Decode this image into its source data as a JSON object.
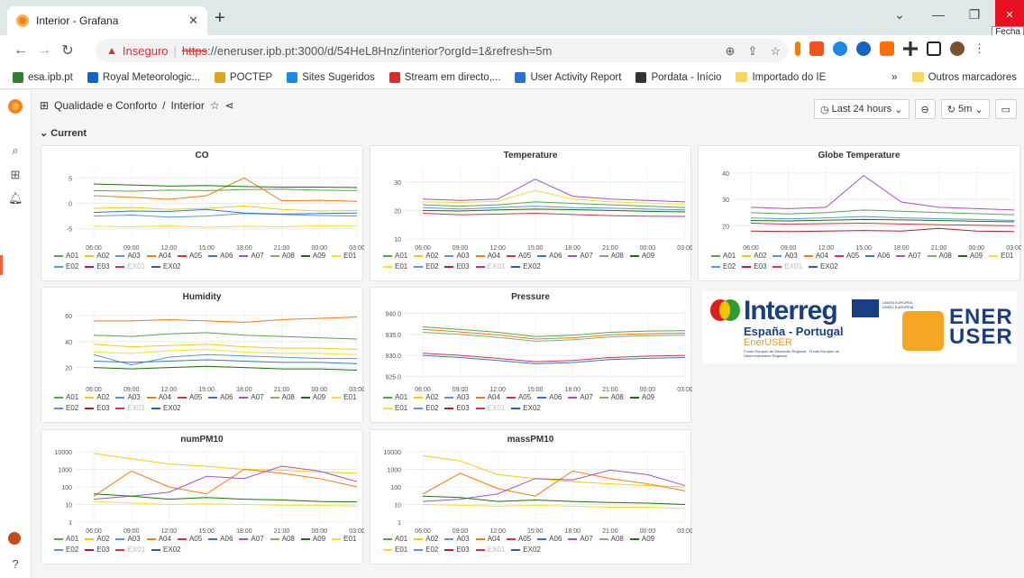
{
  "browser": {
    "tab_title": "Interior - Grafana",
    "close_tooltip": "Fecha",
    "url_warning": "Inseguro",
    "url_scheme": "https",
    "url_rest": "://eneruser.ipb.pt:3000/d/54HeL8Hnz/interior?orgId=1&refresh=5m",
    "bookmarks": [
      {
        "label": "esa.ipb.pt",
        "color": "#2e7d32"
      },
      {
        "label": "Royal Meteorologic...",
        "color": "#1565c0"
      },
      {
        "label": "POCTEP",
        "color": "#d9a71e"
      },
      {
        "label": "Sites Sugeridos",
        "color": "#1e88e5"
      },
      {
        "label": "Stream em directo,...",
        "color": "#d32f2f"
      },
      {
        "label": "User Activity Report",
        "color": "#2b6fd6"
      },
      {
        "label": "Pordata - Início",
        "color": "#333333"
      },
      {
        "label": "Importado do IE",
        "color": "#f7d565"
      }
    ],
    "bookmarks_overflow": "»",
    "other_bookmarks": "Outros marcadores"
  },
  "dashboard": {
    "folder": "Qualidade e Conforto",
    "sep": "/",
    "name": "Interior",
    "time_range": "Last 24 hours",
    "refresh": "5m",
    "row_title": "Current"
  },
  "legend_items": [
    {
      "name": "A01",
      "color": "#56a64b",
      "dim": false
    },
    {
      "name": "A02",
      "color": "#f2cc0c",
      "dim": false
    },
    {
      "name": "A03",
      "color": "#5794f2",
      "dim": false
    },
    {
      "name": "A04",
      "color": "#ff780a",
      "dim": false
    },
    {
      "name": "A05",
      "color": "#e02f44",
      "dim": false
    },
    {
      "name": "A06",
      "color": "#3274d9",
      "dim": false
    },
    {
      "name": "A07",
      "color": "#a352cc",
      "dim": false
    },
    {
      "name": "A08",
      "color": "#7eb26d",
      "dim": false
    },
    {
      "name": "A09",
      "color": "#19730e",
      "dim": false
    },
    {
      "name": "E01",
      "color": "#fade2a",
      "dim": false
    },
    {
      "name": "E02",
      "color": "#5794f2",
      "dim": false
    },
    {
      "name": "E03",
      "color": "#c4162a",
      "dim": false
    },
    {
      "name": "EX01",
      "color": "#e02f44",
      "dim": true
    },
    {
      "name": "EX02",
      "color": "#1f60c4",
      "dim": false
    }
  ],
  "x_ticks": [
    "06:00",
    "09:00",
    "12:00",
    "15:00",
    "18:00",
    "21:00",
    "00:00",
    "03:00"
  ],
  "panels": [
    {
      "title": "CO",
      "y_ticks": [
        "5",
        "0",
        "-5"
      ]
    },
    {
      "title": "Temperature",
      "y_ticks": [
        "30",
        "20",
        "10"
      ]
    },
    {
      "title": "Globe Temperature",
      "y_ticks": [
        "40",
        "30",
        "20"
      ]
    },
    {
      "title": "Humidity",
      "y_ticks": [
        "60",
        "40",
        "20"
      ]
    },
    {
      "title": "Pressure",
      "y_ticks": [
        "940.0",
        "935.0",
        "930.0",
        "925.0"
      ]
    },
    {
      "title": "numPM10",
      "y_ticks": [
        "10000",
        "1000",
        "100",
        "10",
        "1"
      ]
    },
    {
      "title": "massPM10",
      "y_ticks": [
        "10000",
        "1000",
        "100",
        "10",
        "1"
      ]
    }
  ],
  "logo": {
    "interreg": "Interreg",
    "region": "España - Portugal",
    "project": "EnerUSER",
    "fund": "Fondo Europeo de Desarrollo Regional · Fundo Europeu de Desenvolvimento Regional",
    "eu_label": "UNIÓN EUROPEA · UNIÃO EUROPEIA",
    "brand_l1": "ENER",
    "brand_l2": "USER"
  },
  "chart_data": [
    {
      "type": "line",
      "title": "CO",
      "x": [
        "06:00",
        "09:00",
        "12:00",
        "15:00",
        "18:00",
        "21:00",
        "00:00",
        "03:00"
      ],
      "ylim": [
        -7,
        7
      ],
      "series": [
        {
          "name": "A01",
          "values": [
            2.5,
            2.4,
            2.6,
            2.5,
            2.7,
            2.8,
            2.6,
            2.5
          ]
        },
        {
          "name": "A02",
          "values": [
            -1,
            -0.8,
            -1.2,
            -1,
            -0.5,
            -1.2,
            -1.5,
            -1.4
          ]
        },
        {
          "name": "A03",
          "values": [
            -2.5,
            -2.3,
            -2.7,
            -2.5,
            -2,
            -2.2,
            -2.4,
            -2.5
          ]
        },
        {
          "name": "A04",
          "values": [
            1.5,
            1.2,
            0.8,
            1.5,
            5,
            0.5,
            0.6,
            0.4
          ]
        },
        {
          "name": "A06",
          "values": [
            -1.8,
            -1.5,
            -1.6,
            -1.2,
            -1.9,
            -2.1,
            -2,
            -1.9
          ]
        },
        {
          "name": "A09",
          "values": [
            3.8,
            3.6,
            3.4,
            3.5,
            3.3,
            3.2,
            3.2,
            3.1
          ]
        },
        {
          "name": "E01",
          "values": [
            -4.5,
            -4.6,
            -4.4,
            -4.7,
            -4.5,
            -4.6,
            -4.4,
            -4.5
          ]
        }
      ]
    },
    {
      "type": "line",
      "title": "Temperature",
      "x": [
        "06:00",
        "09:00",
        "12:00",
        "15:00",
        "18:00",
        "21:00",
        "00:00",
        "03:00"
      ],
      "ylim": [
        10,
        35
      ],
      "series": [
        {
          "name": "A01",
          "values": [
            22,
            21.5,
            22,
            23,
            22.5,
            22,
            21.5,
            21
          ]
        },
        {
          "name": "A03",
          "values": [
            21,
            20.5,
            21,
            21.5,
            21,
            20.8,
            20.5,
            20.2
          ]
        },
        {
          "name": "A05",
          "values": [
            19,
            18.5,
            18.7,
            19,
            18.6,
            18.2,
            18,
            17.9
          ]
        },
        {
          "name": "A07",
          "values": [
            24,
            23.5,
            24,
            31,
            25,
            24,
            23.5,
            23
          ]
        },
        {
          "name": "A09",
          "values": [
            20,
            19.8,
            20.2,
            20.5,
            20.3,
            20,
            19.7,
            19.5
          ]
        },
        {
          "name": "E01",
          "values": [
            23,
            22.8,
            23.2,
            27,
            24,
            23,
            22.6,
            22.2
          ]
        }
      ]
    },
    {
      "type": "line",
      "title": "Globe Temperature",
      "x": [
        "06:00",
        "09:00",
        "12:00",
        "15:00",
        "18:00",
        "21:00",
        "00:00",
        "03:00"
      ],
      "ylim": [
        15,
        42
      ],
      "series": [
        {
          "name": "A01",
          "values": [
            25,
            24.5,
            25,
            26,
            25.5,
            25,
            24.6,
            24.2
          ]
        },
        {
          "name": "A03",
          "values": [
            23,
            22.6,
            23,
            23.5,
            23,
            22.7,
            22.4,
            22
          ]
        },
        {
          "name": "A05",
          "values": [
            21,
            20.6,
            20.8,
            21,
            20.7,
            20.4,
            20.2,
            20
          ]
        },
        {
          "name": "A07",
          "values": [
            27,
            26.5,
            27,
            39,
            29,
            27,
            26.5,
            26
          ]
        },
        {
          "name": "A09",
          "values": [
            22,
            21.8,
            22.1,
            22.4,
            22.2,
            22,
            21.7,
            21.5
          ]
        },
        {
          "name": "E03",
          "values": [
            18,
            17.8,
            18,
            18.2,
            18,
            19,
            18,
            17.8
          ]
        }
      ]
    },
    {
      "type": "line",
      "title": "Humidity",
      "x": [
        "06:00",
        "09:00",
        "12:00",
        "15:00",
        "18:00",
        "21:00",
        "00:00",
        "03:00"
      ],
      "ylim": [
        10,
        65
      ],
      "series": [
        {
          "name": "A01",
          "values": [
            45,
            44,
            46,
            47,
            45,
            44,
            43,
            42
          ]
        },
        {
          "name": "A02",
          "values": [
            38,
            36,
            37,
            38,
            36,
            35,
            35,
            34
          ]
        },
        {
          "name": "A03",
          "values": [
            30,
            22,
            28,
            30,
            29,
            28,
            27,
            27
          ]
        },
        {
          "name": "A04",
          "values": [
            56,
            56,
            57,
            56,
            55,
            57,
            58,
            59
          ]
        },
        {
          "name": "A06",
          "values": [
            25,
            24,
            25,
            26,
            25,
            24,
            24,
            23
          ]
        },
        {
          "name": "A09",
          "values": [
            20,
            19,
            20,
            21,
            20,
            19,
            19,
            18
          ]
        },
        {
          "name": "E01",
          "values": [
            32,
            31,
            33,
            34,
            32,
            31,
            31,
            30
          ]
        }
      ]
    },
    {
      "type": "line",
      "title": "Pressure",
      "x": [
        "06:00",
        "09:00",
        "12:00",
        "15:00",
        "18:00",
        "21:00",
        "00:00",
        "03:00"
      ],
      "ylim": [
        924,
        941
      ],
      "series": [
        {
          "name": "A01",
          "values": [
            936.8,
            936.2,
            935.5,
            934.5,
            934.8,
            935.5,
            935.8,
            935.9
          ]
        },
        {
          "name": "A04",
          "values": [
            936.2,
            935.6,
            934.9,
            933.9,
            934.2,
            934.9,
            935.2,
            935.3
          ]
        },
        {
          "name": "A05",
          "values": [
            930.5,
            930,
            929.3,
            928.5,
            928.8,
            929.5,
            929.8,
            930
          ]
        },
        {
          "name": "A06",
          "values": [
            930,
            929.5,
            928.8,
            928,
            928.3,
            929,
            929.3,
            929.5
          ]
        },
        {
          "name": "A08",
          "values": [
            935.5,
            935,
            934.3,
            933.4,
            933.7,
            934.4,
            934.7,
            934.8
          ]
        }
      ]
    },
    {
      "type": "line",
      "title": "numPM10",
      "x": [
        "06:00",
        "09:00",
        "12:00",
        "15:00",
        "18:00",
        "21:00",
        "00:00",
        "03:00"
      ],
      "ylim": [
        1,
        10000
      ],
      "series": [
        {
          "name": "A02",
          "values": [
            8000,
            4000,
            2000,
            1500,
            1000,
            900,
            700,
            600
          ]
        },
        {
          "name": "A04",
          "values": [
            30,
            800,
            100,
            40,
            1000,
            600,
            300,
            100
          ]
        },
        {
          "name": "A07",
          "values": [
            20,
            30,
            50,
            400,
            300,
            1500,
            800,
            200
          ]
        },
        {
          "name": "A09",
          "values": [
            40,
            30,
            20,
            25,
            20,
            18,
            15,
            14
          ]
        },
        {
          "name": "E01",
          "values": [
            15,
            12,
            10,
            11,
            10,
            9,
            9,
            8
          ]
        }
      ]
    },
    {
      "type": "line",
      "title": "massPM10",
      "x": [
        "06:00",
        "09:00",
        "12:00",
        "15:00",
        "18:00",
        "21:00",
        "00:00",
        "03:00"
      ],
      "ylim": [
        1,
        10000
      ],
      "series": [
        {
          "name": "A02",
          "values": [
            6000,
            3000,
            500,
            300,
            200,
            150,
            120,
            100
          ]
        },
        {
          "name": "A04",
          "values": [
            40,
            600,
            80,
            30,
            800,
            300,
            150,
            60
          ]
        },
        {
          "name": "A07",
          "values": [
            15,
            20,
            40,
            300,
            250,
            900,
            500,
            120
          ]
        },
        {
          "name": "A09",
          "values": [
            30,
            25,
            15,
            18,
            15,
            13,
            12,
            10
          ]
        },
        {
          "name": "E01",
          "values": [
            10,
            9,
            8,
            9,
            8,
            7,
            7,
            6
          ]
        }
      ]
    }
  ]
}
